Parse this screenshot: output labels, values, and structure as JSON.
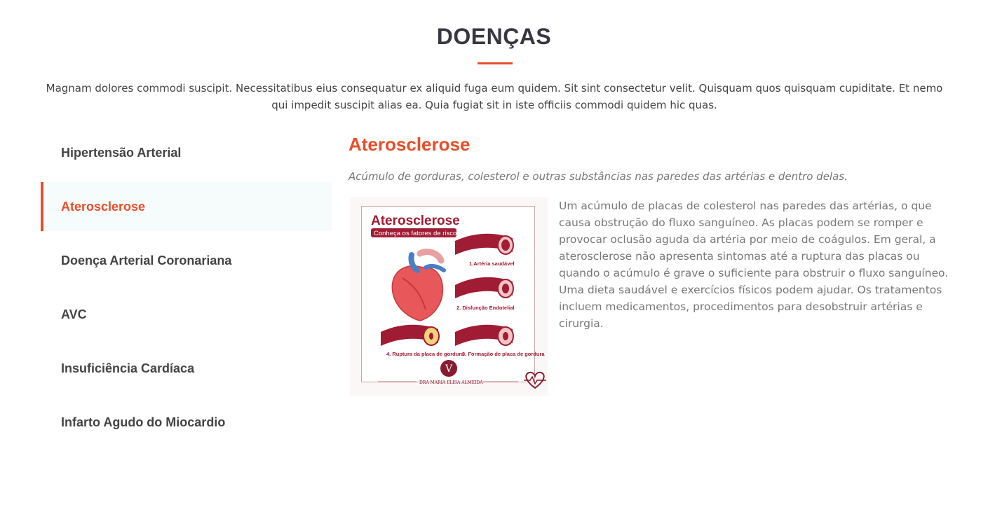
{
  "section": {
    "title": "DOENÇAS",
    "intro": "Magnam dolores commodi suscipit. Necessitatibus eius consequatur ex aliquid fuga eum quidem. Sit sint consectetur velit. Quisquam quos quisquam cupiditate. Et nemo qui impedit suscipit alias ea. Quia fugiat sit in iste officiis commodi quidem hic quas."
  },
  "tabs": [
    {
      "label": "Hipertensão Arterial",
      "active": false
    },
    {
      "label": "Aterosclerose",
      "active": true
    },
    {
      "label": "Doença Arterial Coronariana",
      "active": false
    },
    {
      "label": "AVC",
      "active": false
    },
    {
      "label": "Insuficiência Cardíaca",
      "active": false
    },
    {
      "label": "Infarto Agudo do Miocardio",
      "active": false
    }
  ],
  "content": {
    "title": "Aterosclerose",
    "lead": "Acúmulo de gorduras, colesterol e outras substâncias nas paredes das artérias e dentro delas.",
    "body": "Um acúmulo de placas de colesterol nas paredes das artérias, o que causa obstrução do fluxo sanguíneo. As placas podem se romper e provocar oclusão aguda da artéria por meio de coágulos. Em geral, a aterosclerose não apresenta sintomas até a ruptura das placas ou quando o acúmulo é grave o suficiente para obstruir o fluxo sanguíneo. Uma dieta saudável e exercícios físicos podem ajudar. Os tratamentos incluem medicamentos, procedimentos para desobstruir artérias e cirurgia."
  },
  "figure": {
    "title": "Aterosclerose",
    "subtitle": "Conheça os fatores de risco",
    "stages": [
      {
        "label": "1.Artéria saudável"
      },
      {
        "label": "2. Disfunção Endotelial"
      },
      {
        "label": "3. Formação de placa de gordura"
      },
      {
        "label": "4. Ruptura da placa de gordura"
      }
    ],
    "signature": "DRA MARIA ELISA ALMEIDA",
    "logo_letter": "V"
  },
  "colors": {
    "accent": "#e84e2a",
    "heading": "#37373f",
    "text": "#444444",
    "muted": "#777777",
    "active_tab_bg": "#f6fbfb",
    "infographic_red": "#a01c34"
  },
  "icons": {
    "heart": "heart-illustration-icon",
    "heartbeat": "heartbeat-icon"
  }
}
